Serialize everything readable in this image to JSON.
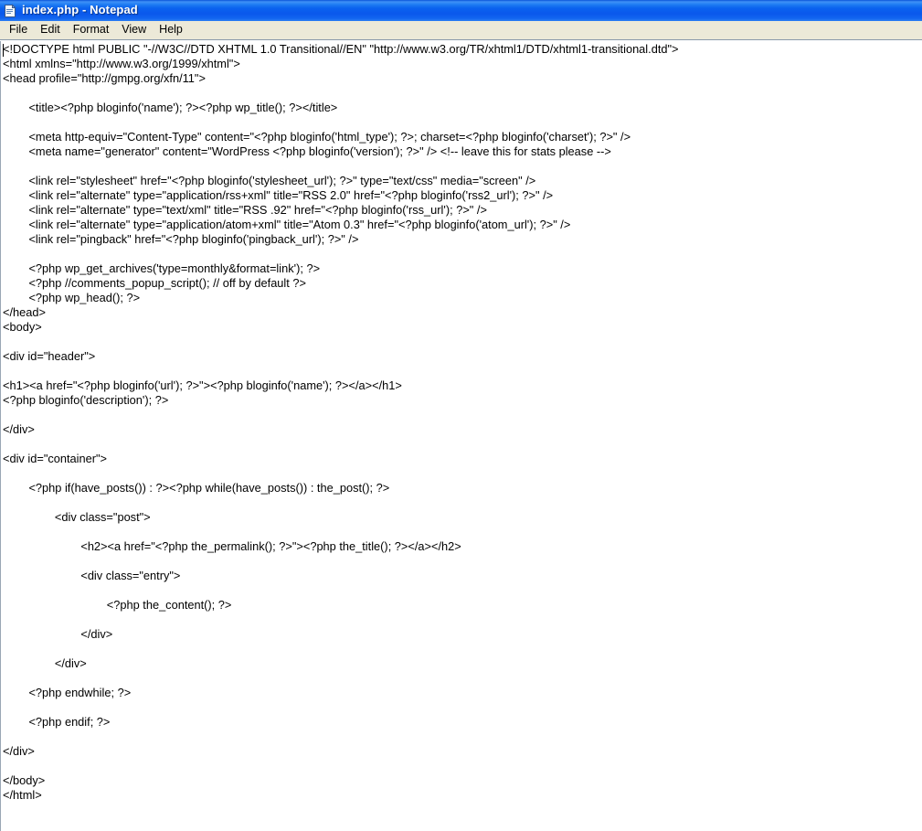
{
  "window": {
    "title": "index.php - Notepad",
    "icon": "notepad-document-icon",
    "titlebar_gradient_top": "#3f92f7",
    "titlebar_gradient_mid": "#0a58ec",
    "titlebar_text_color": "#ffffff",
    "menubar_background": "#ece9d8",
    "client_background": "#ffffff"
  },
  "menu": {
    "items": [
      {
        "label": "File"
      },
      {
        "label": "Edit"
      },
      {
        "label": "Format"
      },
      {
        "label": "View"
      },
      {
        "label": "Help"
      }
    ]
  },
  "editor": {
    "caret_visible": true,
    "caret_line": 1,
    "caret_column": 1,
    "wordwrap": false,
    "content": "<!DOCTYPE html PUBLIC \"-//W3C//DTD XHTML 1.0 Transitional//EN\" \"http://www.w3.org/TR/xhtml1/DTD/xhtml1-transitional.dtd\">\n<html xmlns=\"http://www.w3.org/1999/xhtml\">\n<head profile=\"http://gmpg.org/xfn/11\">\n\n\t<title><?php bloginfo('name'); ?><?php wp_title(); ?></title>\n\n\t<meta http-equiv=\"Content-Type\" content=\"<?php bloginfo('html_type'); ?>; charset=<?php bloginfo('charset'); ?>\" />\n\t<meta name=\"generator\" content=\"WordPress <?php bloginfo('version'); ?>\" /> <!-- leave this for stats please -->\n\n\t<link rel=\"stylesheet\" href=\"<?php bloginfo('stylesheet_url'); ?>\" type=\"text/css\" media=\"screen\" />\n\t<link rel=\"alternate\" type=\"application/rss+xml\" title=\"RSS 2.0\" href=\"<?php bloginfo('rss2_url'); ?>\" />\n\t<link rel=\"alternate\" type=\"text/xml\" title=\"RSS .92\" href=\"<?php bloginfo('rss_url'); ?>\" />\n\t<link rel=\"alternate\" type=\"application/atom+xml\" title=\"Atom 0.3\" href=\"<?php bloginfo('atom_url'); ?>\" />\n\t<link rel=\"pingback\" href=\"<?php bloginfo('pingback_url'); ?>\" />\n\n\t<?php wp_get_archives('type=monthly&format=link'); ?>\n\t<?php //comments_popup_script(); // off by default ?>\n\t<?php wp_head(); ?>\n</head>\n<body>\n\n<div id=\"header\">\n\n<h1><a href=\"<?php bloginfo('url'); ?>\"><?php bloginfo('name'); ?></a></h1>\n<?php bloginfo('description'); ?>\n\n</div>\n\n<div id=\"container\">\n\n\t<?php if(have_posts()) : ?><?php while(have_posts()) : the_post(); ?>\n\n\t\t<div class=\"post\">\n\n\t\t\t<h2><a href=\"<?php the_permalink(); ?>\"><?php the_title(); ?></a></h2>\n\n\t\t\t<div class=\"entry\">\n\n\t\t\t\t<?php the_content(); ?>\n\n\t\t\t</div>\n\n\t\t</div>\n\n\t<?php endwhile; ?>\n\n\t<?php endif; ?>\n\n</div>\n\n</body>\n</html>"
  }
}
